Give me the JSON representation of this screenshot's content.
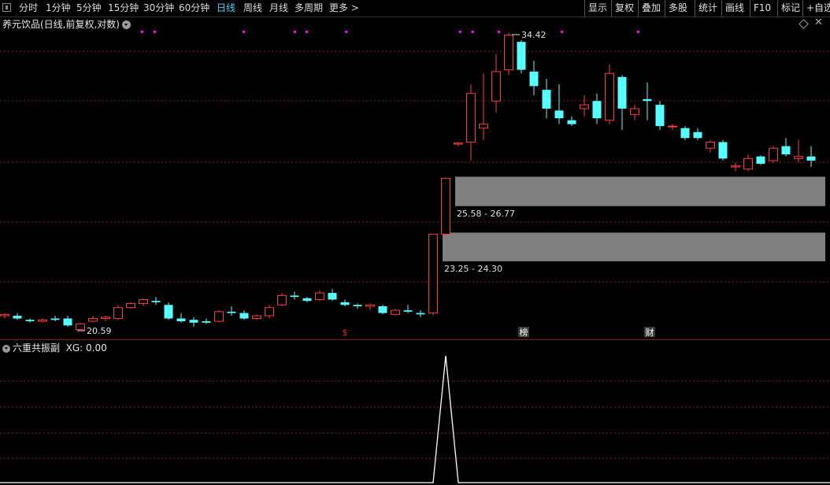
{
  "toolbar": {
    "periods": [
      "分时",
      "1分钟",
      "5分钟",
      "15分钟",
      "30分钟",
      "60分钟",
      "日线",
      "周线",
      "月线",
      "多周期",
      "更多 >"
    ],
    "active_period": "日线",
    "right_buttons": [
      "显示",
      "复权",
      "叠加",
      "多股",
      "统计",
      "画线",
      "F10",
      "标记",
      "+自选"
    ]
  },
  "main_chart": {
    "title": "养元饮品(日线,前复权,对数)",
    "max_label": "34.42",
    "min_label": "20.59",
    "zones": [
      {
        "label": "25.58 - 26.77",
        "low": 25.58,
        "high": 26.77
      },
      {
        "label": "23.25 - 24.30",
        "low": 23.25,
        "high": 24.3
      }
    ],
    "event_markers": [
      {
        "label": "$",
        "color": "#e03030"
      },
      {
        "label": "榜",
        "color": "#ffffff"
      },
      {
        "label": "财",
        "color": "#ffffff"
      }
    ]
  },
  "indicator": {
    "title": "六重共振副",
    "value_text": "XG: 0.00"
  },
  "colors": {
    "up": "#ff3b3b",
    "down": "#54ffff",
    "grid": "#8a1a1a",
    "zone": "#808080",
    "marker": "#ff00ff",
    "line": "#ffffff"
  },
  "chart_data": {
    "type": "candlestick",
    "scale": "log",
    "ohlc": [
      [
        21.1,
        21.2,
        21.0,
        21.15
      ],
      [
        21.1,
        21.2,
        20.95,
        21.0
      ],
      [
        20.95,
        21.0,
        20.85,
        20.9
      ],
      [
        20.9,
        21.0,
        20.85,
        20.95
      ],
      [
        21.0,
        21.1,
        20.9,
        20.95
      ],
      [
        21.0,
        21.1,
        20.7,
        20.75
      ],
      [
        20.6,
        20.85,
        20.59,
        20.8
      ],
      [
        20.9,
        21.1,
        20.85,
        21.0
      ],
      [
        21.0,
        21.1,
        20.9,
        21.05
      ],
      [
        21.0,
        21.5,
        20.95,
        21.4
      ],
      [
        21.4,
        21.6,
        21.35,
        21.55
      ],
      [
        21.55,
        21.75,
        21.45,
        21.7
      ],
      [
        21.65,
        21.8,
        21.5,
        21.6
      ],
      [
        21.5,
        21.6,
        20.95,
        21.0
      ],
      [
        21.0,
        21.2,
        20.85,
        20.9
      ],
      [
        20.95,
        21.05,
        20.7,
        20.85
      ],
      [
        20.9,
        21.0,
        20.8,
        20.85
      ],
      [
        20.9,
        21.3,
        20.85,
        21.25
      ],
      [
        21.25,
        21.45,
        21.1,
        21.2
      ],
      [
        21.2,
        21.3,
        20.95,
        21.0
      ],
      [
        21.0,
        21.15,
        20.95,
        21.1
      ],
      [
        21.1,
        21.5,
        21.0,
        21.4
      ],
      [
        21.5,
        21.95,
        21.45,
        21.85
      ],
      [
        21.85,
        22.0,
        21.7,
        21.8
      ],
      [
        21.75,
        21.8,
        21.6,
        21.65
      ],
      [
        21.7,
        22.05,
        21.65,
        21.95
      ],
      [
        21.95,
        22.1,
        21.65,
        21.7
      ],
      [
        21.6,
        21.7,
        21.45,
        21.5
      ],
      [
        21.5,
        21.55,
        21.35,
        21.45
      ],
      [
        21.45,
        21.55,
        21.3,
        21.5
      ],
      [
        21.45,
        21.5,
        21.15,
        21.2
      ],
      [
        21.15,
        21.35,
        21.1,
        21.3
      ],
      [
        21.3,
        21.5,
        21.2,
        21.25
      ],
      [
        21.2,
        21.3,
        21.05,
        21.15
      ],
      [
        21.2,
        24.3,
        21.1,
        24.3
      ],
      [
        24.3,
        26.8,
        24.2,
        26.77
      ],
      [
        28.4,
        28.5,
        28.3,
        28.45
      ],
      [
        28.5,
        31.5,
        27.6,
        31.0
      ],
      [
        29.2,
        32.1,
        28.6,
        29.4
      ],
      [
        30.6,
        33.2,
        30.0,
        32.2
      ],
      [
        32.3,
        34.42,
        32.0,
        34.3
      ],
      [
        33.9,
        34.0,
        32.1,
        32.3
      ],
      [
        32.2,
        32.8,
        30.9,
        31.4
      ],
      [
        31.2,
        31.8,
        29.7,
        30.2
      ],
      [
        30.1,
        31.5,
        29.4,
        29.7
      ],
      [
        29.6,
        29.8,
        29.3,
        29.4
      ],
      [
        30.2,
        30.9,
        29.8,
        30.4
      ],
      [
        30.6,
        31.0,
        29.4,
        29.7
      ],
      [
        29.6,
        32.6,
        29.4,
        32.1
      ],
      [
        31.9,
        32.0,
        29.1,
        30.2
      ],
      [
        29.9,
        30.4,
        29.6,
        30.2
      ],
      [
        30.7,
        31.6,
        29.6,
        30.6
      ],
      [
        30.4,
        30.6,
        29.1,
        29.3
      ],
      [
        29.3,
        29.4,
        29.1,
        29.3
      ],
      [
        29.2,
        29.3,
        28.6,
        28.7
      ],
      [
        29.0,
        29.2,
        28.6,
        28.7
      ],
      [
        28.2,
        28.6,
        28.0,
        28.5
      ],
      [
        28.5,
        28.6,
        27.6,
        27.7
      ],
      [
        27.3,
        27.5,
        27.1,
        27.35
      ],
      [
        27.2,
        27.9,
        27.1,
        27.7
      ],
      [
        27.8,
        27.85,
        27.4,
        27.45
      ],
      [
        27.6,
        28.3,
        27.5,
        28.2
      ],
      [
        28.3,
        28.7,
        27.8,
        27.9
      ],
      [
        27.7,
        28.6,
        27.5,
        27.8
      ],
      [
        27.8,
        28.3,
        27.3,
        27.6
      ]
    ],
    "max": {
      "value": 34.42,
      "index": 40
    },
    "min": {
      "value": 20.59,
      "index": 6
    },
    "indicator_series": {
      "name": "XG",
      "spike_index": 34,
      "values_note": "0 everywhere except 1 at spike"
    }
  }
}
